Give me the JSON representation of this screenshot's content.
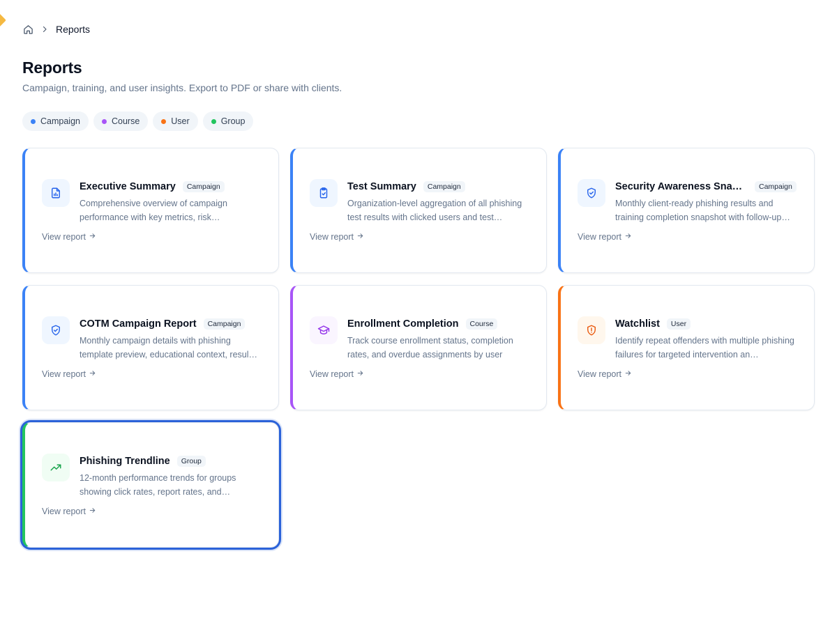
{
  "breadcrumb": {
    "current": "Reports"
  },
  "page": {
    "title": "Reports",
    "subtitle": "Campaign, training, and user insights. Export to PDF or share with clients."
  },
  "legend": [
    {
      "label": "Campaign",
      "color": "#3b82f6"
    },
    {
      "label": "Course",
      "color": "#a855f7"
    },
    {
      "label": "User",
      "color": "#f97316"
    },
    {
      "label": "Group",
      "color": "#22c55e"
    }
  ],
  "reports": [
    {
      "title": "Executive Summary",
      "badge": "Campaign",
      "description": "Comprehensive overview of campaign performance with key metrics, risk…",
      "link": "View report",
      "icon": "report-chart-icon",
      "accent": "#3b82f6",
      "icon_bg": "#eff6ff",
      "icon_color": "#2563eb"
    },
    {
      "title": "Test Summary",
      "badge": "Campaign",
      "description": "Organization-level aggregation of all phishing test results with clicked users and test…",
      "link": "View report",
      "icon": "clipboard-check-icon",
      "accent": "#3b82f6",
      "icon_bg": "#eff6ff",
      "icon_color": "#2563eb"
    },
    {
      "title": "Security Awareness Snap…",
      "badge": "Campaign",
      "description": "Monthly client-ready phishing results and training completion snapshot with follow-up…",
      "link": "View report",
      "icon": "shield-check-icon",
      "accent": "#3b82f6",
      "icon_bg": "#eff6ff",
      "icon_color": "#2563eb"
    },
    {
      "title": "COTM Campaign Report",
      "badge": "Campaign",
      "description": "Monthly campaign details with phishing template preview, educational context, resul…",
      "link": "View report",
      "icon": "shield-check-icon",
      "accent": "#3b82f6",
      "icon_bg": "#eff6ff",
      "icon_color": "#2563eb"
    },
    {
      "title": "Enrollment Completion",
      "badge": "Course",
      "description": "Track course enrollment status, completion rates, and overdue assignments by user",
      "link": "View report",
      "icon": "graduation-cap-icon",
      "accent": "#a855f7",
      "icon_bg": "#faf5ff",
      "icon_color": "#9333ea"
    },
    {
      "title": "Watchlist",
      "badge": "User",
      "description": "Identify repeat offenders with multiple phishing failures for targeted intervention an…",
      "link": "View report",
      "icon": "shield-alert-icon",
      "accent": "#f97316",
      "icon_bg": "#fff7ed",
      "icon_color": "#ea580c"
    },
    {
      "title": "Phishing Trendline",
      "badge": "Group",
      "description": "12-month performance trends for groups showing click rates, report rates, and…",
      "link": "View report",
      "icon": "trending-up-icon",
      "accent": "#22c55e",
      "icon_bg": "#f0fdf4",
      "icon_color": "#16a34a",
      "selected": true
    }
  ]
}
